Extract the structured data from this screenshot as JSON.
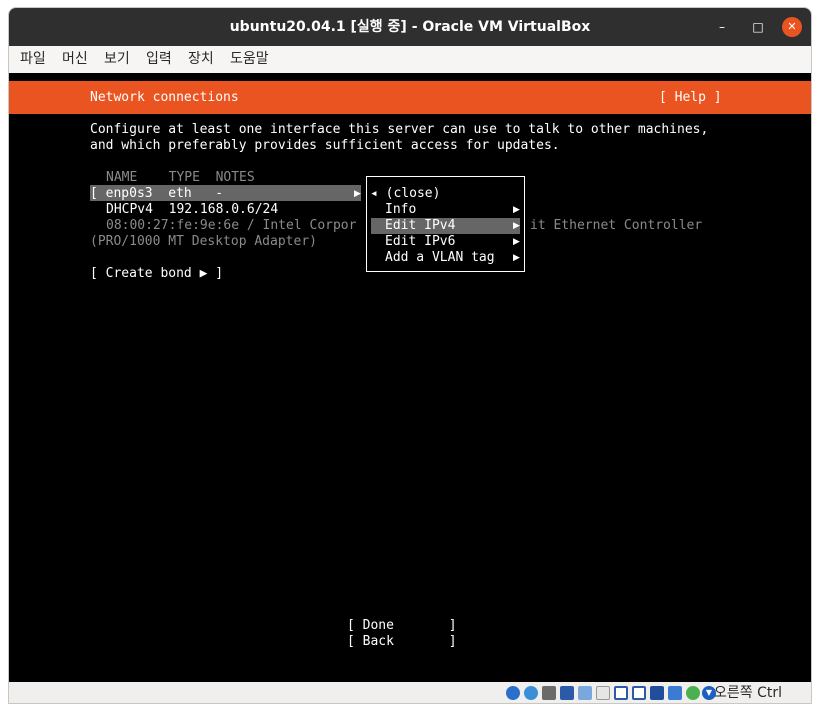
{
  "window": {
    "title": "ubuntu20.04.1 [실행 중] - Oracle VM VirtualBox",
    "controls": {
      "minimize": "–",
      "maximize": "□",
      "close": "✕"
    }
  },
  "menubar": {
    "items": [
      "파일",
      "머신",
      "보기",
      "입력",
      "장치",
      "도움말"
    ]
  },
  "installer": {
    "header_title": "Network connections",
    "help": "[ Help ]",
    "description_line1": "Configure at least one interface this server can use to talk to other machines,",
    "description_line2": "and which preferably provides sufficient access for updates.",
    "table_header": "NAME    TYPE  NOTES",
    "interface_row": "[ enp0s3  eth   -",
    "interface_arrow": "▶",
    "dhcp_row": "DHCPv4  192.168.0.6/24",
    "mac_row_left": "08:00:27:fe:9e:6e / Intel Corpor",
    "mac_row_right": "it Ethernet Controller",
    "mac_row_line2": "(PRO/1000 MT Desktop Adapter)",
    "create_bond": "[ Create bond ▶ ]",
    "done_button": "[ Done       ]",
    "back_button": "[ Back       ]"
  },
  "popup_menu": {
    "items": [
      {
        "label": "◂ (close)",
        "arrow": ""
      },
      {
        "label": "Info",
        "arrow": "▶"
      },
      {
        "label": "Edit IPv4",
        "arrow": "▶",
        "selected": true
      },
      {
        "label": "Edit IPv6",
        "arrow": "▶"
      },
      {
        "label": "Add a VLAN tag",
        "arrow": "▶"
      }
    ]
  },
  "statusbar": {
    "host_key": "오른쪽 Ctrl",
    "icons": [
      "hard-disk-icon",
      "optical-drive-icon",
      "audio-icon",
      "network-icon",
      "usb-icon",
      "shared-folders-icon",
      "display-icon",
      "recording-icon",
      "cpu-icon",
      "mouse-integration-icon",
      "keyboard-capture-icon"
    ]
  },
  "colors": {
    "accent": "#e95420",
    "titlebar": "#2f2f2f",
    "console_bg": "#000000",
    "selection": "#666666"
  }
}
